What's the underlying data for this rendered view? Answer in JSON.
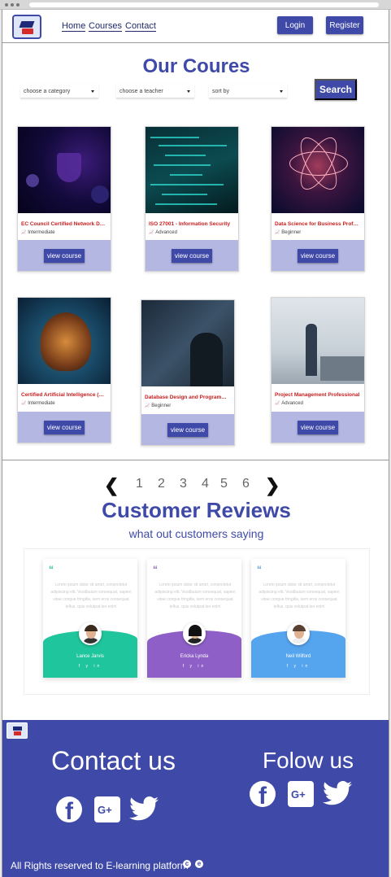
{
  "nav": {
    "home": "Home",
    "courses": "Courses",
    "contact": "Contact",
    "login": "Login",
    "register": "Register"
  },
  "courses_section": {
    "title": "Our Coures",
    "filters": [
      "choose a category",
      "choose a teacher",
      "sort by"
    ],
    "search": "Search",
    "view_label": "view course",
    "cards": [
      {
        "title": "EC Council Certified Network Defen...",
        "level": "Intermediate"
      },
      {
        "title": "ISO 27001 - Information Security",
        "level": "Advanced"
      },
      {
        "title": "Data Science for Business Profession...",
        "level": "Beginner"
      },
      {
        "title": "Certified Artificial Intelligence (AI) P...",
        "level": "Intermediate"
      },
      {
        "title": "Database Design and Programming",
        "level": "Beginner"
      },
      {
        "title": "Project Management Professional",
        "level": "Advanced"
      }
    ]
  },
  "pagination": {
    "pages": [
      "1",
      "2",
      "3",
      "4",
      "5",
      "6"
    ]
  },
  "reviews": {
    "title": "Customer Reviews",
    "subtitle": "what out customers saying",
    "text": "Lorem ipsum dolor sit amet, consectetur adipiscing elit. Vestibulum consequat, sapien vitae congue fringilla, sem eros consequat tellus, quis volutpat leo enim",
    "items": [
      {
        "name": "Lance Jarvis",
        "color": "#1fc59c"
      },
      {
        "name": "Ericka Lynda",
        "color": "#8e5fc6"
      },
      {
        "name": "Neil Wilford",
        "color": "#55a4ee"
      }
    ],
    "social": "f y in"
  },
  "footer": {
    "contact_title": "Contact us",
    "follow_title": "Folow us",
    "rights": "All Rights reserved to E-learning platform",
    "brand_color": "#3f4aa8"
  }
}
